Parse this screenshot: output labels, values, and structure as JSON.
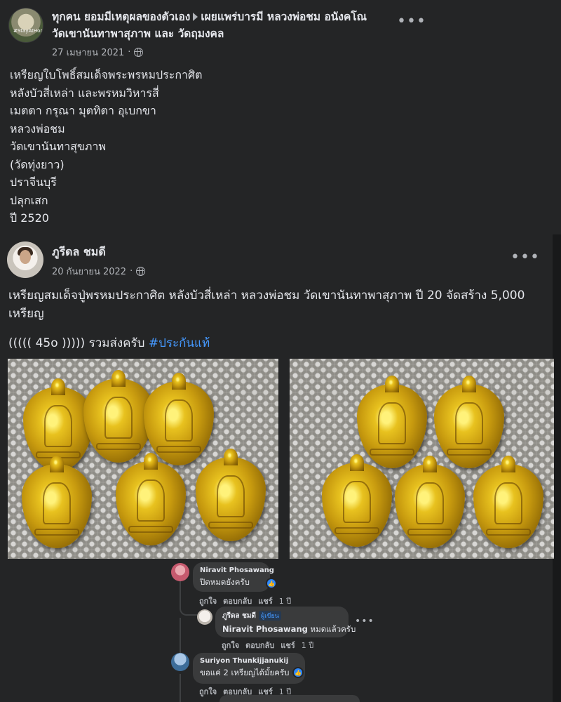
{
  "post1": {
    "title_part1": "ทุกคน ยอมมีเหตุผลของตัวเอง",
    "title_part2": "เผยแพร่บารมี หลวงพ่อชม อนังคโณ วัดเขานันทาพาสุภาพ และ วัดฤมงคล",
    "avatar_tag": "#StayAtHome",
    "date": "27 เมษายน 2021",
    "lines": [
      "เหรียญใบโพธิ์สมเด็จพระพรหมประกาศิต",
      "หลังบัวสี่เหล่า และพรหมวิหารสี่",
      "เมตตา กรุณา มุตทิตา อุเบกขา",
      "หลวงพ่อชม",
      "วัดเขานันทาสุขภาพ",
      "(วัดทุ่งยาว)",
      "ปราจีนบุรี",
      "ปลุกเสก",
      "ปี 2520"
    ]
  },
  "post2": {
    "author": "ภูรีดล ชมดี",
    "date": "20 กันยายน 2022",
    "text": "เหรียญสมเด็จปู่พรหมประกาศิต หลังบัวสี่เหล่า หลวงพ่อชม วัดเขานันทาพาสุภาพ ปี 20 จัดสร้าง 5,000 เหรียญ",
    "price_text": "((((( 45o ))))) รวมส่งครับ",
    "hashtag": "#ประกันแท้"
  },
  "comments": [
    {
      "name": "Niravit Phosawang",
      "text": "ปิดหมดยังครับ",
      "like": "ถูกใจ",
      "reply": "ตอบกลับ",
      "share": "แชร์",
      "time": "1 ปี"
    },
    {
      "name": "ภูรีดล ชมดี",
      "badge": "ผู้เขียน",
      "mention": "Niravit Phosawang",
      "text": "หมดแล้วครับ",
      "like": "ถูกใจ",
      "reply": "ตอบกลับ",
      "share": "แชร์",
      "time": "1 ปี"
    },
    {
      "name": "Suriyon Thunkijjanukij",
      "text": "ขอแค่ 2 เหรียญได้มั้ยครับ",
      "like": "ถูกใจ",
      "reply": "ตอบกลับ",
      "share": "แชร์",
      "time": "1 ปี"
    }
  ],
  "icons": {
    "more": "more-options-icon",
    "globe": "globe-icon",
    "like": "like-icon"
  },
  "colors": {
    "background": "#18191a",
    "card": "#242526",
    "bubble": "#3a3b3c",
    "text": "#e4e6eb",
    "muted": "#b0b3b8",
    "link": "#4599ff"
  }
}
